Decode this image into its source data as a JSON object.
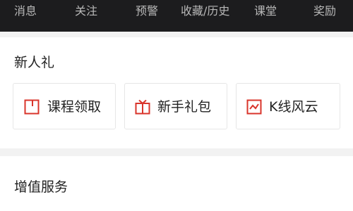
{
  "top_nav": {
    "items": [
      {
        "label": "消息"
      },
      {
        "label": "关注"
      },
      {
        "label": "预警"
      },
      {
        "label": "收藏/历史"
      },
      {
        "label": "课堂"
      },
      {
        "label": "奖励"
      }
    ]
  },
  "new_user_gift": {
    "title": "新人礼",
    "buttons": [
      {
        "label": "课程领取",
        "icon": "bookmark-icon"
      },
      {
        "label": "新手礼包",
        "icon": "gift-box-icon"
      },
      {
        "label": "K线风云",
        "icon": "line-chart-icon"
      }
    ]
  },
  "value_added": {
    "title": "增值服务"
  },
  "colors": {
    "top_bar_bg": "#1c1c1e",
    "top_nav_text": "#b8b8b8",
    "icon_red": "#d9342b",
    "page_bg": "#f2f2f2"
  }
}
